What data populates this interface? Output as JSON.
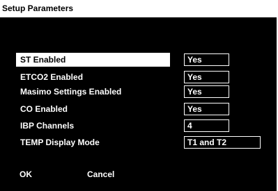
{
  "window": {
    "title": "Setup Parameters"
  },
  "parameters": [
    {
      "label": "ST Enabled",
      "value": "Yes",
      "selected": true
    },
    {
      "label": "ETCO2 Enabled",
      "value": "Yes",
      "selected": false
    },
    {
      "label": "Masimo Settings Enabled",
      "value": "Yes",
      "selected": false
    },
    {
      "label": "CO Enabled",
      "value": "Yes",
      "selected": false
    },
    {
      "label": "IBP Channels",
      "value": "4",
      "selected": false
    },
    {
      "label": "TEMP Display Mode",
      "value": "T1 and T2",
      "selected": false
    }
  ],
  "buttons": {
    "ok_label": "OK",
    "cancel_label": "Cancel"
  },
  "colors": {
    "panel_background": "#000000",
    "text": "#ffffff",
    "selection_background": "#ffffff",
    "selection_text": "#000000"
  }
}
